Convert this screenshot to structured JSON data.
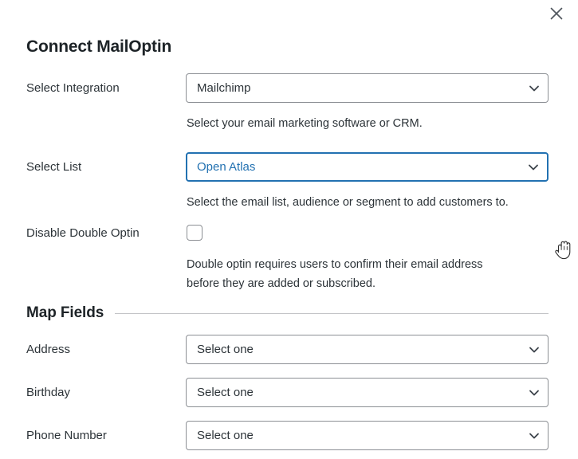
{
  "window": {
    "close_label": "×",
    "close_icon": "close-icon"
  },
  "modal": {
    "title": "Connect MailOptin"
  },
  "colors": {
    "accent": "#2271b1",
    "border": "#8c8f94",
    "text": "#2c3338",
    "heading": "#1d2327",
    "rule": "#c3c4c7"
  },
  "settings": {
    "integration": {
      "label": "Select Integration",
      "value": "Mailchimp",
      "help": "Select your email marketing software or CRM.",
      "chevron_icon": "chevron-down-icon"
    },
    "list": {
      "label": "Select List",
      "value": "Open Atlas",
      "help": "Select the email list, audience or segment to add customers to.",
      "chevron_icon": "chevron-down-icon",
      "focused": true
    },
    "double_optin": {
      "label": "Disable Double Optin",
      "checked": false,
      "help_line1": "Double optin requires users to confirm their email address",
      "help_line2": "before they are added or subscribed."
    }
  },
  "map_fields": {
    "section_title": "Map Fields",
    "rows": [
      {
        "label": "Address",
        "value": "Select one",
        "chevron_icon": "chevron-down-icon"
      },
      {
        "label": "Birthday",
        "value": "Select one",
        "chevron_icon": "chevron-down-icon"
      },
      {
        "label": "Phone Number",
        "value": "Select one",
        "chevron_icon": "chevron-down-icon"
      }
    ]
  },
  "cursor": {
    "type": "grab-hand-cursor"
  }
}
